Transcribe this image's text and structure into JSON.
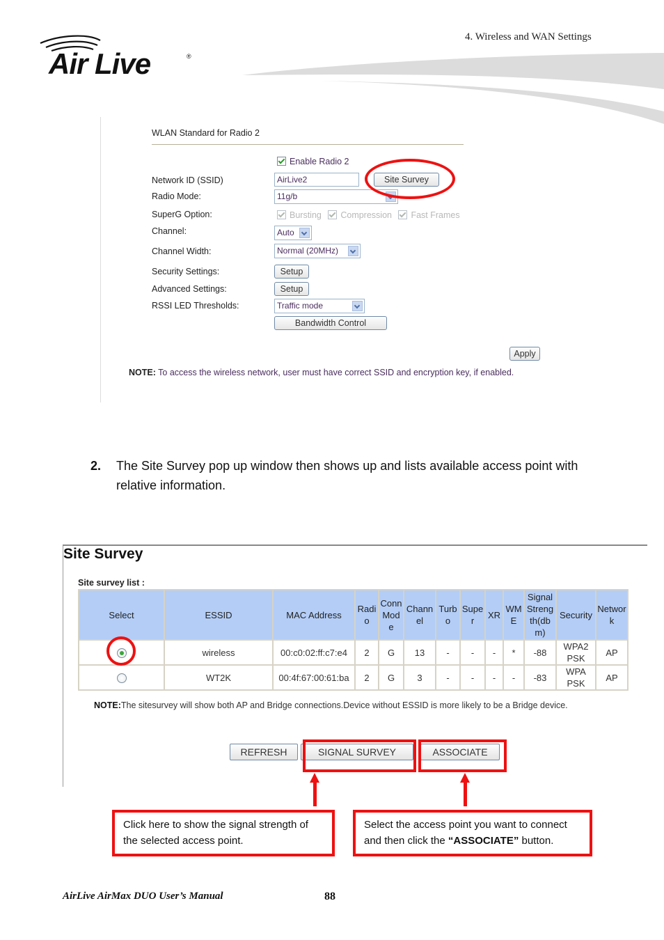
{
  "header": {
    "brand": "Air Live",
    "chapter": "4. Wireless and WAN Settings"
  },
  "wlan_form": {
    "title": "WLAN Standard for Radio 2",
    "enable_radio_label": "Enable Radio 2",
    "enable_radio_checked": true,
    "fields": {
      "ssid_label": "Network ID (SSID)",
      "ssid_value": "AirLive2",
      "site_survey_button": "Site Survey",
      "radio_mode_label": "Radio Mode:",
      "radio_mode_value": "11g/b",
      "superg_label": "SuperG Option:",
      "superg_options": [
        "Bursting",
        "Compression",
        "Fast Frames"
      ],
      "channel_label": "Channel:",
      "channel_value": "Auto",
      "channel_width_label": "Channel Width:",
      "channel_width_value": "Normal (20MHz)",
      "security_label": "Security Settings:",
      "security_button": "Setup",
      "advanced_label": "Advanced Settings:",
      "advanced_button": "Setup",
      "rssi_label": "RSSI LED Thresholds:",
      "rssi_value": "Traffic mode",
      "bandwidth_button": "Bandwidth Control"
    },
    "apply_button": "Apply",
    "note_prefix": "NOTE:",
    "note_text": " To access the wireless network, user must have correct SSID and encryption key, if enabled."
  },
  "step": {
    "number": "2.",
    "text": "The Site Survey pop up window then shows up and lists available access point with relative information."
  },
  "site_survey": {
    "title": "Site Survey",
    "list_label": "Site survey list :",
    "columns": [
      "Select",
      "ESSID",
      "MAC Address",
      "Radio",
      "Conn Mode",
      "Channel",
      "Turbo",
      "Super",
      "XR",
      "WME",
      "Signal Strength(dbm)",
      "Security",
      "Network"
    ],
    "column_display": [
      "Select",
      "ESSID",
      "MAC Address",
      "Radi\no",
      "Conn\nMod\ne",
      "Chann\nel",
      "Turb\no",
      "Supe\nr",
      "XR",
      "WM\nE",
      "Signal\nStreng\nth(db\nm)",
      "Security",
      "Networ\nk"
    ],
    "rows": [
      {
        "selected": true,
        "essid": "wireless",
        "mac": "00:c0:02:ff:c7:e4",
        "radio": "2",
        "conn_mode": "G",
        "channel": "13",
        "turbo": "-",
        "super": "-",
        "xr": "-",
        "wme": "*",
        "signal": "-88",
        "security": "WPA2\nPSK",
        "network": "AP"
      },
      {
        "selected": false,
        "essid": "WT2K",
        "mac": "00:4f:67:00:61:ba",
        "radio": "2",
        "conn_mode": "G",
        "channel": "3",
        "turbo": "-",
        "super": "-",
        "xr": "-",
        "wme": "-",
        "signal": "-83",
        "security": "WPA\nPSK",
        "network": "AP"
      }
    ],
    "note_prefix": "NOTE:",
    "note_text": "The sitesurvey will show both AP and Bridge connections.Device without ESSID is more likely to be a Bridge device.",
    "buttons": {
      "refresh": "REFRESH",
      "signal_survey": "SIGNAL SURVEY",
      "associate": "ASSOCIATE"
    }
  },
  "callouts": {
    "signal": "Click here to show the signal strength of the selected access point.",
    "associate_pre": "Select the access point you want to connect and then click the ",
    "associate_bold": "“ASSOCIATE”",
    "associate_post": " button."
  },
  "footer": {
    "manual_title": "AirLive AirMax DUO User’s Manual",
    "page_number": "88"
  },
  "colors": {
    "highlight_red": "#ee1111",
    "table_header_blue": "#b3cdf6",
    "swoosh_gray": "#dcdcdc"
  }
}
